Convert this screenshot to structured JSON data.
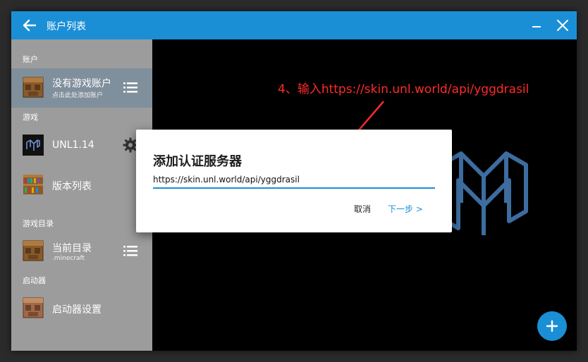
{
  "window": {
    "title": "账户列表"
  },
  "sidebar": {
    "sections": [
      {
        "label": "账户"
      },
      {
        "label": "游戏"
      },
      {
        "label": "游戏目录"
      },
      {
        "label": "启动器"
      }
    ],
    "account": {
      "name": "没有游戏账户",
      "sub": "点击此处添加账户"
    },
    "game": {
      "name": "UNL1.14"
    },
    "versions": {
      "name": "版本列表"
    },
    "directory": {
      "name": "当前目录",
      "sub": ".minecraft"
    },
    "launcher": {
      "name": "启动器设置"
    }
  },
  "annotation": {
    "text": "4、输入https://skin.unl.world/api/yggdrasil",
    "color": "#ff2a2a"
  },
  "dialog": {
    "title": "添加认证服务器",
    "input_value": "https://skin.unl.world/api/yggdrasil",
    "cancel_label": "取消",
    "next_label": "下一步 >"
  },
  "colors": {
    "accent": "#1b8fd6",
    "sidebar": "#9c9c9c",
    "selected": "#808f9c"
  },
  "icons": [
    "back-arrow-icon",
    "minimize-icon",
    "close-icon",
    "crafting-table-icon",
    "menu-icon",
    "settings-gear-icon",
    "bookshelf-icon",
    "plus-icon",
    "unl-logo-icon"
  ]
}
